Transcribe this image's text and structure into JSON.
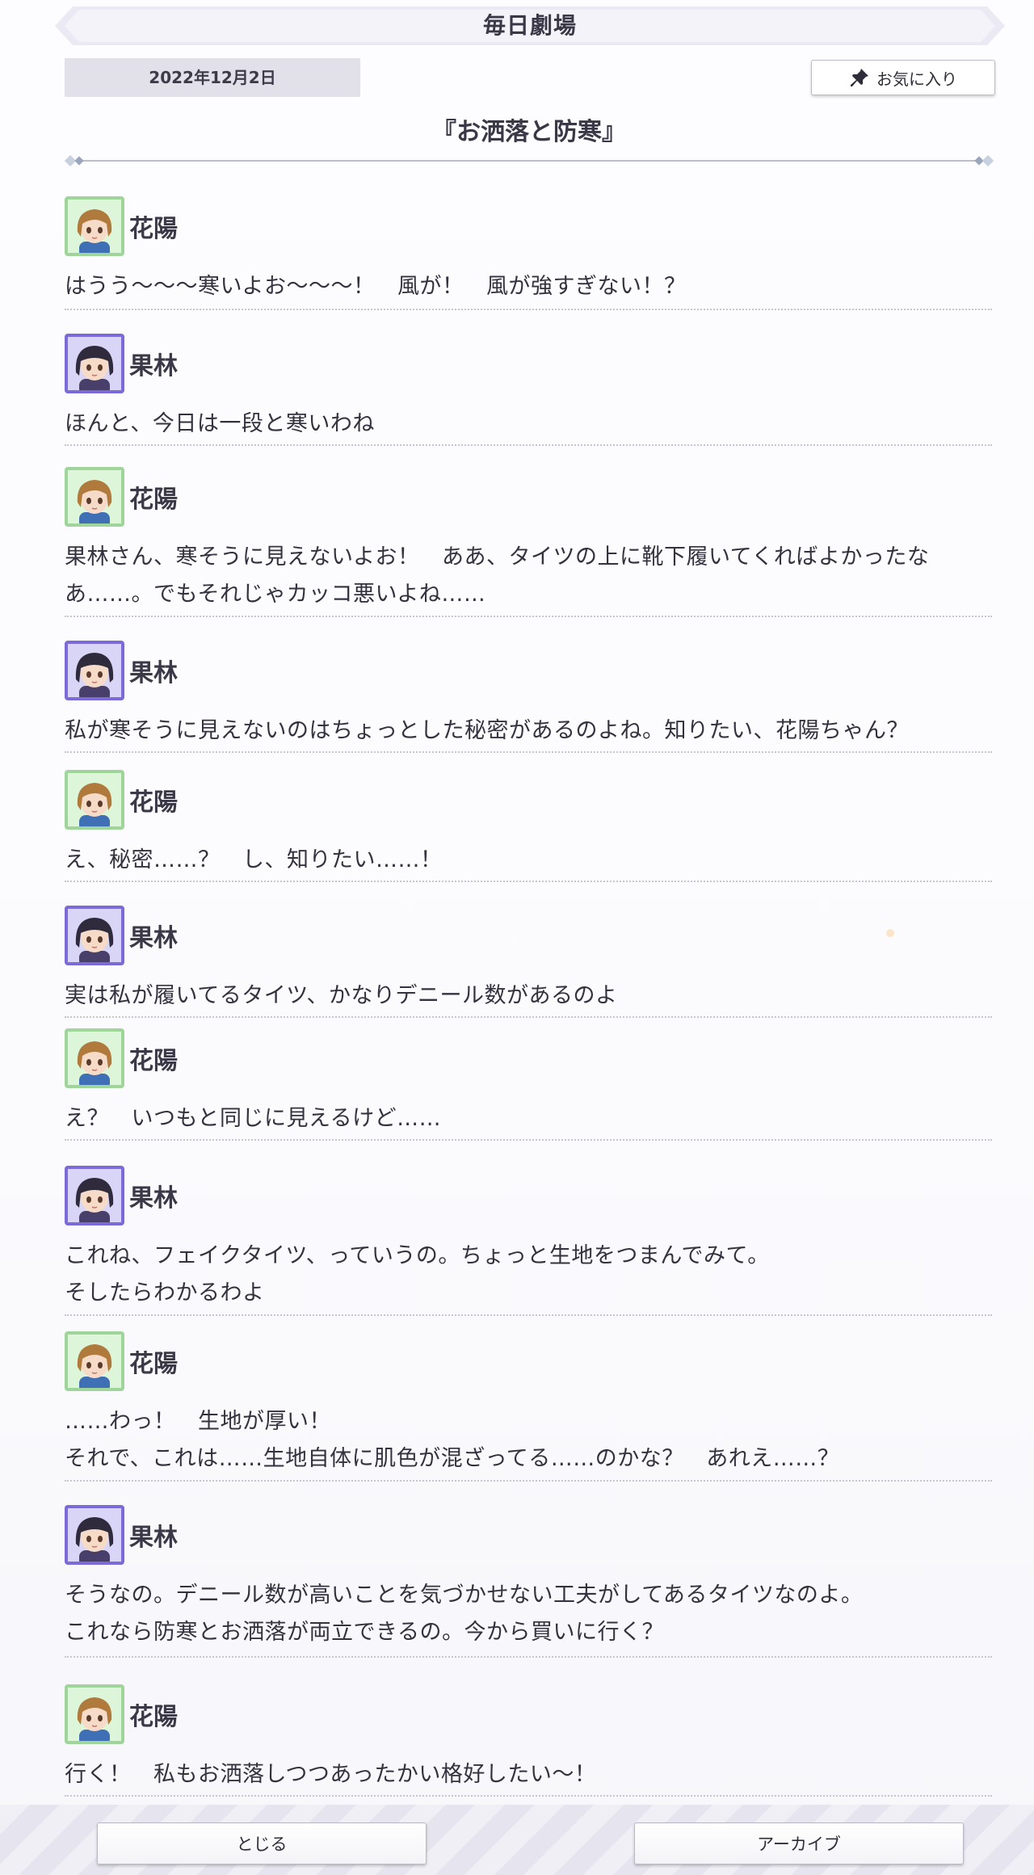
{
  "header": {
    "title": "毎日劇場"
  },
  "date": "2022年12月2日",
  "favorite_button": {
    "label": "お気に入り",
    "icon": "pin-icon"
  },
  "story_title": "『お洒落と防寒』",
  "dialogue": [
    {
      "speaker": "花陽",
      "avatar": "hanayo",
      "lines": [
        "はうう〜〜〜寒いよお〜〜〜！　風が！　風が強すぎない！？"
      ]
    },
    {
      "speaker": "果林",
      "avatar": "karin",
      "lines": [
        "ほんと、今日は一段と寒いわね"
      ]
    },
    {
      "speaker": "花陽",
      "avatar": "hanayo",
      "lines": [
        "果林さん、寒そうに見えないよお！　ああ、タイツの上に靴下履いてくればよかったな",
        "あ……。でもそれじゃカッコ悪いよね……"
      ]
    },
    {
      "speaker": "果林",
      "avatar": "karin",
      "lines": [
        "私が寒そうに見えないのはちょっとした秘密があるのよね。知りたい、花陽ちゃん？"
      ]
    },
    {
      "speaker": "花陽",
      "avatar": "hanayo",
      "lines": [
        "え、秘密……？　し、知りたい……！"
      ]
    },
    {
      "speaker": "果林",
      "avatar": "karin",
      "lines": [
        "実は私が履いてるタイツ、かなりデニール数があるのよ"
      ]
    },
    {
      "speaker": "花陽",
      "avatar": "hanayo",
      "lines": [
        "え？　いつもと同じに見えるけど……"
      ]
    },
    {
      "speaker": "果林",
      "avatar": "karin",
      "lines": [
        "これね、フェイクタイツ、っていうの。ちょっと生地をつまんでみて。",
        "そしたらわかるわよ"
      ]
    },
    {
      "speaker": "花陽",
      "avatar": "hanayo",
      "lines": [
        "……わっ！　生地が厚い！",
        "それで、これは……生地自体に肌色が混ざってる……のかな？　あれえ……？"
      ]
    },
    {
      "speaker": "果林",
      "avatar": "karin",
      "lines": [
        "そうなの。デニール数が高いことを気づかせない工夫がしてあるタイツなのよ。",
        "これなら防寒とお洒落が両立できるの。今から買いに行く？"
      ]
    },
    {
      "speaker": "花陽",
      "avatar": "hanayo",
      "lines": [
        "行く！　私もお洒落しつつあったかい格好したい〜！"
      ]
    }
  ],
  "footer": {
    "close_label": "とじる",
    "archive_label": "アーカイブ"
  },
  "colors": {
    "hanayo_frame": "#9fd49a",
    "karin_frame": "#7b6ad8",
    "ribbon": "#e9e8f3"
  }
}
